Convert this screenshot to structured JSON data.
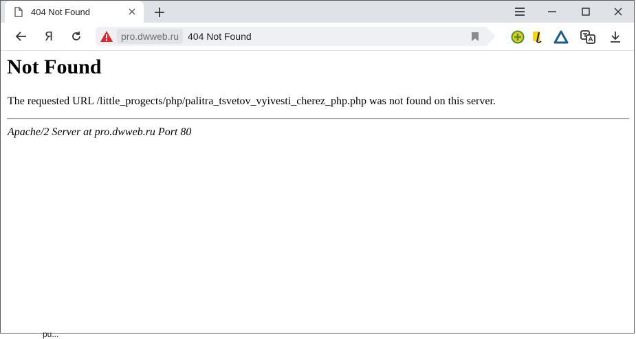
{
  "tab": {
    "title": "404 Not Found",
    "file_icon": "page-icon",
    "close_icon": "close-icon"
  },
  "new_tab_icon": "plus-icon",
  "window_controls": [
    "menu-icon",
    "minimize-icon",
    "maximize-icon",
    "close-icon"
  ],
  "toolbar": {
    "back_icon": "back-arrow-icon",
    "yandex_logo": "Я",
    "reload_icon": "reload-icon",
    "warning_icon": "warning-icon",
    "domain": "pro.dwweb.ru",
    "page_title": "404 Not Found",
    "bookmark_icon": "bookmark-icon",
    "extensions": [
      "green-extension-icon",
      "yellow-extension-icon",
      "alice-icon",
      "translate-icon",
      "download-icon"
    ]
  },
  "page": {
    "heading": "Not Found",
    "message": "The requested URL /little_progects/php/palitra_tsvetov_vyivesti_cherez_php.php was not found on this server.",
    "address": "Apache/2 Server at pro.dwweb.ru Port 80"
  },
  "below_window_text": "pu..."
}
